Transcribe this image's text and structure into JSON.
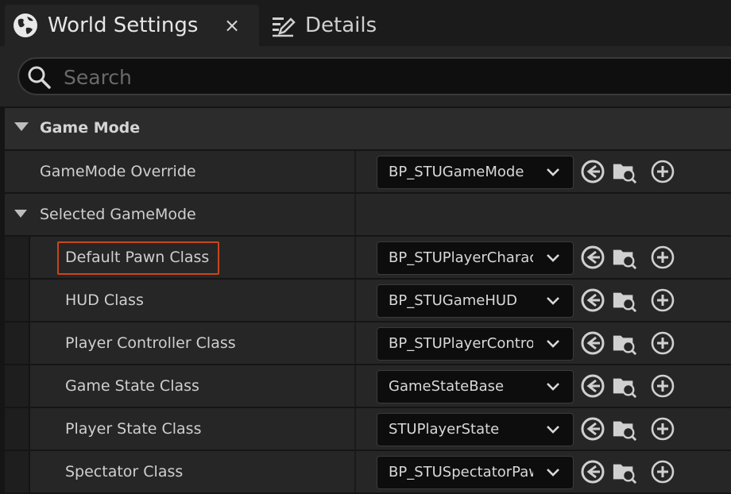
{
  "tabs": [
    {
      "label": "World Settings",
      "icon": "globe-icon",
      "active": true,
      "close_label": "×"
    },
    {
      "label": "Details",
      "icon": "pencil-details-icon",
      "active": false
    }
  ],
  "search": {
    "placeholder": "Search",
    "value": ""
  },
  "category": {
    "label": "Game Mode"
  },
  "gamemode_override": {
    "label": "GameMode Override",
    "value": "BP_STUGameMode"
  },
  "selected_gamemode": {
    "label": "Selected GameMode"
  },
  "properties": [
    {
      "label": "Default Pawn Class",
      "value": "BP_STUPlayerCharacter",
      "highlighted": true
    },
    {
      "label": "HUD Class",
      "value": "BP_STUGameHUD"
    },
    {
      "label": "Player Controller Class",
      "value": "BP_STUPlayerController"
    },
    {
      "label": "Game State Class",
      "value": "GameStateBase"
    },
    {
      "label": "Player State Class",
      "value": "STUPlayerState"
    },
    {
      "label": "Spectator Class",
      "value": "BP_STUSpectatorPawn"
    }
  ],
  "colors": {
    "highlight": "#c8461e",
    "background": "#242424",
    "panel": "#262626"
  }
}
